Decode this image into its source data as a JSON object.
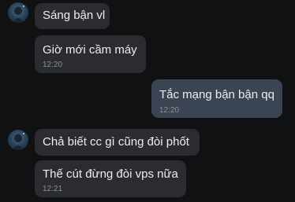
{
  "theme": {
    "background": "#0f1113",
    "incoming_bubble": "#2a2c30",
    "outgoing_bubble": "#3b4452",
    "text": "#eceef0",
    "timestamp": "#8b9098"
  },
  "messages": [
    {
      "id": "m1",
      "direction": "incoming",
      "text": "Sáng bận vl",
      "time": ""
    },
    {
      "id": "m2",
      "direction": "incoming",
      "text": "Giờ mới cầm máy",
      "time": "12:20"
    },
    {
      "id": "m3",
      "direction": "outgoing",
      "text": "Tắc mạng bận bận qq",
      "time": "12:20"
    },
    {
      "id": "m4",
      "direction": "incoming",
      "text": "Chả biết cc gì cũng đòi phốt",
      "time": ""
    },
    {
      "id": "m5",
      "direction": "incoming",
      "text": "Thế cút đừng đòi vps nữa",
      "time": "12:21"
    }
  ],
  "avatars": [
    {
      "icon": "anime-character-avatar-icon"
    },
    {
      "icon": "anime-character-avatar-icon"
    }
  ]
}
